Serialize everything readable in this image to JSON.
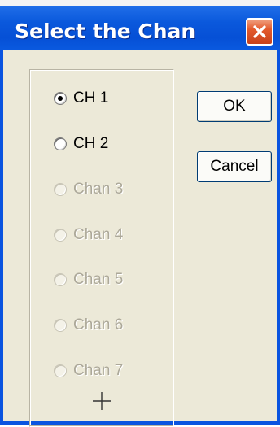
{
  "window": {
    "title": "Select the Chan"
  },
  "channels": [
    {
      "label": "CH 1",
      "checked": true,
      "enabled": true
    },
    {
      "label": "CH 2",
      "checked": false,
      "enabled": true
    },
    {
      "label": "Chan 3",
      "checked": false,
      "enabled": false
    },
    {
      "label": "Chan 4",
      "checked": false,
      "enabled": false
    },
    {
      "label": "Chan 5",
      "checked": false,
      "enabled": false
    },
    {
      "label": "Chan 6",
      "checked": false,
      "enabled": false
    },
    {
      "label": "Chan 7",
      "checked": false,
      "enabled": false
    }
  ],
  "buttons": {
    "ok_label": "OK",
    "cancel_label": "Cancel"
  },
  "icons": {
    "close": "close-icon",
    "cursor": "crosshair-cursor-icon"
  },
  "colors": {
    "titlebar": "#0a58dc",
    "client": "#ece9d8",
    "close": "#e35a2c",
    "disabled_text": "#aca899"
  }
}
